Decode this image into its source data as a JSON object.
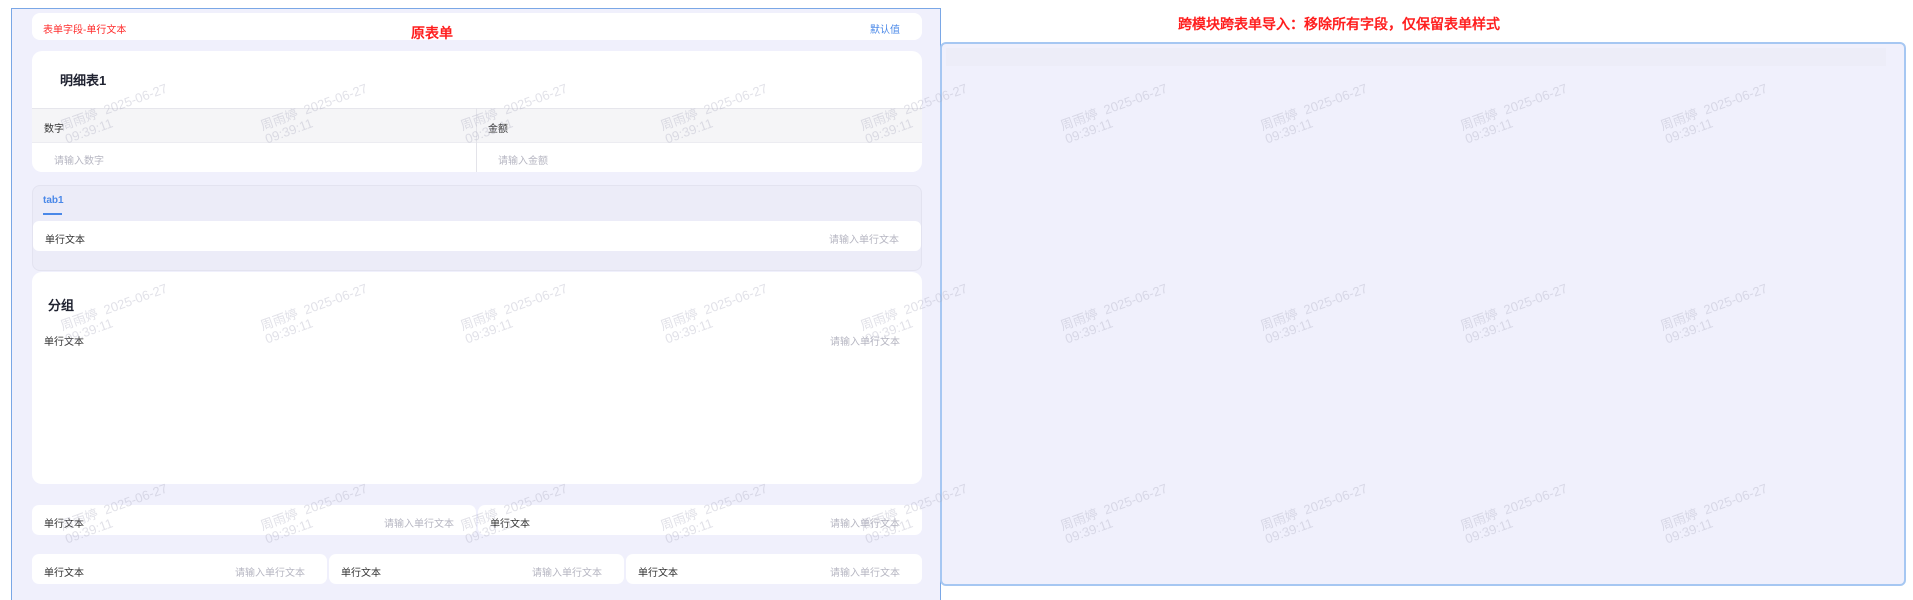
{
  "left": {
    "section_title": "原表单",
    "top_row": {
      "label": "表单字段-单行文本",
      "default_label": "默认值"
    },
    "detail_table": {
      "title": "明细表1",
      "columns": [
        {
          "header": "数字",
          "placeholder": "请输入数字"
        },
        {
          "header": "金额",
          "placeholder": "请输入金额"
        }
      ]
    },
    "tabs": {
      "active_tab": "tab1",
      "field": {
        "label": "单行文本",
        "placeholder": "请输入单行文本"
      }
    },
    "group": {
      "title": "分组",
      "field": {
        "label": "单行文本",
        "placeholder": "请输入单行文本"
      }
    },
    "two_col_row": [
      {
        "label": "单行文本",
        "placeholder": "请输入单行文本"
      },
      {
        "label": "单行文本",
        "placeholder": "请输入单行文本"
      }
    ],
    "three_col_row": [
      {
        "label": "单行文本",
        "placeholder": "请输入单行文本"
      },
      {
        "label": "单行文本",
        "placeholder": "请输入单行文本"
      },
      {
        "label": "单行文本",
        "placeholder": "请输入单行文本"
      }
    ]
  },
  "right": {
    "section_title": "跨模块跨表单导入：移除所有字段，仅保留表单样式"
  },
  "watermark": {
    "name": "周雨婷",
    "date": "2025-06-27",
    "time": "09:39:11"
  },
  "colors": {
    "panel_bg": "#f0f0fc",
    "accent_blue": "#4a88e8",
    "title_red": "#ff1e1e",
    "panel_border": "#7aa7e6"
  }
}
